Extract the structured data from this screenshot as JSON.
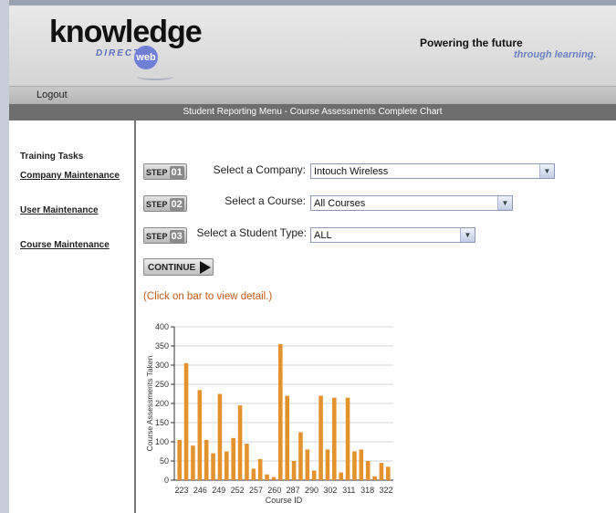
{
  "header": {
    "logo_main": "knowledge",
    "logo_sub": "DIRECT",
    "logo_badge": "web",
    "tagline_line1": "Powering the future",
    "tagline_line2": "through learning."
  },
  "topbar": {
    "logout_label": "Logout"
  },
  "title_bar": {
    "text": "Student Reporting Menu - Course Assessments Complete Chart"
  },
  "sidebar": {
    "heading": "Training Tasks",
    "links": [
      "Company Maintenance",
      "User Maintenance",
      "Course Maintenance"
    ]
  },
  "steps": [
    {
      "badge": "STEP",
      "number": "01",
      "label": "Select a Company:",
      "value": "Intouch Wireless"
    },
    {
      "badge": "STEP",
      "number": "02",
      "label": "Select a Course:",
      "value": "All Courses"
    },
    {
      "badge": "STEP",
      "number": "03",
      "label": "Select a Student Type:",
      "value": "ALL"
    }
  ],
  "continue_label": "CONTINUE",
  "hint": "(Click on bar to view detail.)",
  "colors": {
    "bar": "#e3922e",
    "hint": "#c05a1a",
    "title_bar": "#6e6e6e"
  },
  "chart_data": {
    "type": "bar",
    "xlabel": "Course ID",
    "ylabel": "Course Assessments Taken",
    "ylim": [
      0,
      400
    ],
    "yticks": [
      0,
      50,
      100,
      150,
      200,
      250,
      300,
      350,
      400
    ],
    "xtick_labels": [
      "223",
      "246",
      "249",
      "252",
      "257",
      "260",
      "287",
      "290",
      "302",
      "311",
      "318",
      "322"
    ],
    "values": [
      105,
      305,
      90,
      235,
      105,
      70,
      225,
      75,
      110,
      195,
      95,
      30,
      55,
      15,
      8,
      355,
      220,
      50,
      125,
      80,
      25,
      220,
      80,
      215,
      20,
      215,
      75,
      80,
      50,
      10,
      45,
      35
    ],
    "grid": true
  }
}
